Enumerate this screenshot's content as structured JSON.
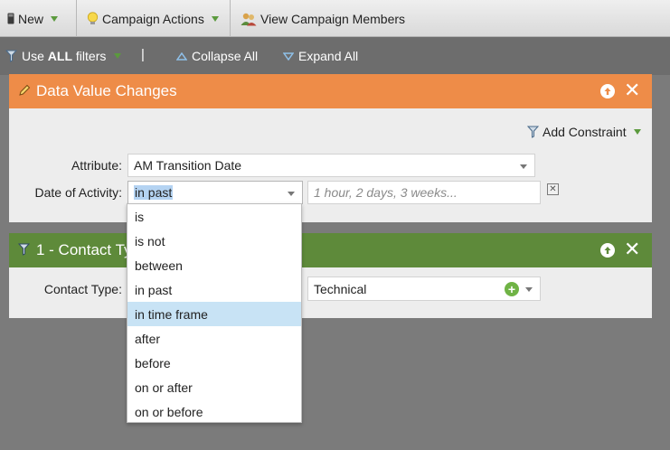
{
  "toolbar": {
    "new_label": "New",
    "campaign_actions_label": "Campaign Actions",
    "view_members_label": "View Campaign Members"
  },
  "filterbar": {
    "use_filters_prefix": "Use",
    "use_filters_bold": "ALL",
    "use_filters_suffix": "filters",
    "separator": "|",
    "collapse_label": "Collapse All",
    "expand_label": "Expand All"
  },
  "panel1": {
    "title": "Data Value Changes",
    "add_constraint_label": "Add Constraint",
    "attribute_label": "Attribute:",
    "attribute_value": "AM Transition Date",
    "date_label": "Date of Activity:",
    "date_operator": "in past",
    "date_placeholder": "1 hour, 2 days, 3 weeks..."
  },
  "panel2": {
    "title": "1 - Contact Ty",
    "contact_label": "Contact Type:",
    "contact_value": "Technical"
  },
  "dropdown": {
    "options": [
      "is",
      "is not",
      "between",
      "in past",
      "in time frame",
      "after",
      "before",
      "on or after",
      "on or before"
    ],
    "highlighted": "in time frame"
  },
  "colors": {
    "orange_header": "#ee8c48",
    "green_header": "#5e8a3a",
    "highlight": "#c8e3f5"
  }
}
